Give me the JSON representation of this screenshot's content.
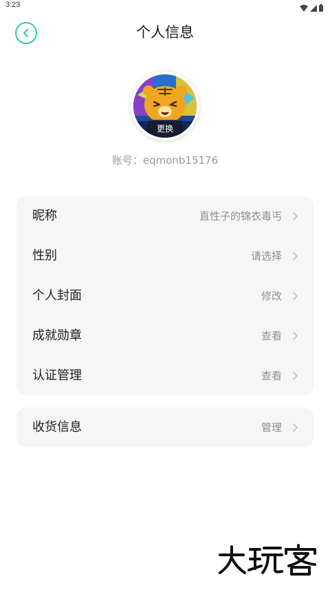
{
  "status_bar": {
    "time": "3:23",
    "icons": [
      "wifi-icon",
      "signal-icon",
      "battery-icon"
    ]
  },
  "header": {
    "back_icon": "chevron-left-icon",
    "title": "个人信息"
  },
  "profile": {
    "avatar_overlay_label": "更换",
    "account_text": "账号：eqmonb15176"
  },
  "groups": [
    {
      "rows": [
        {
          "label": "昵称",
          "value": "直性子的锦衣毒丐"
        },
        {
          "label": "性别",
          "value": "请选择"
        },
        {
          "label": "个人封面",
          "value": "修改"
        },
        {
          "label": "成就勋章",
          "value": "查看"
        },
        {
          "label": "认证管理",
          "value": "查看"
        }
      ]
    },
    {
      "rows": [
        {
          "label": "收货信息",
          "value": "管理"
        }
      ]
    }
  ],
  "watermark": {
    "text": "大玩客"
  },
  "colors": {
    "accent": "#2ec9b4",
    "card_background": "#f6f6f7",
    "secondary_text": "#8f8f8f"
  }
}
